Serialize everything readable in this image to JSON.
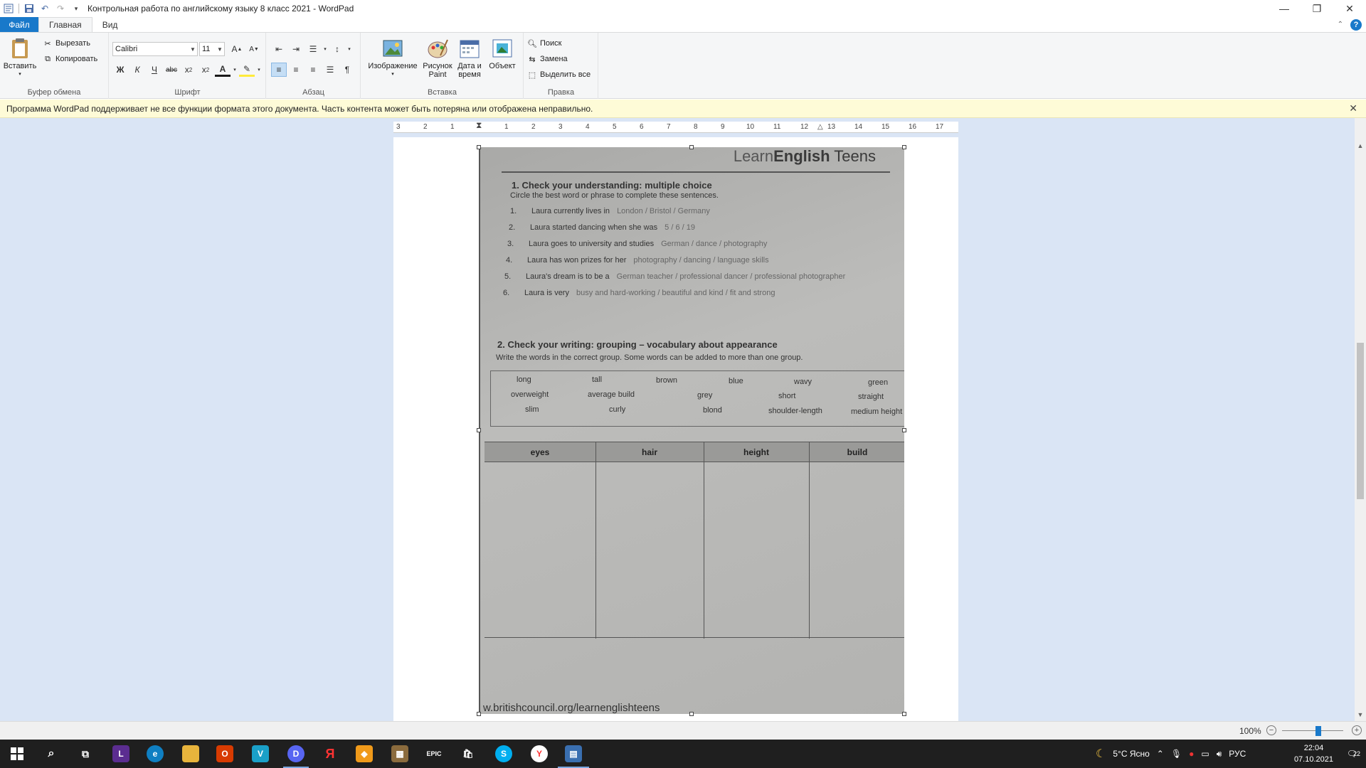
{
  "titlebar": {
    "title": "Контрольная работа по английскому языку 8 класс 2021 - WordPad"
  },
  "tabs": {
    "file": "Файл",
    "home": "Главная",
    "view": "Вид"
  },
  "clipboard": {
    "paste": "Вставить",
    "cut": "Вырезать",
    "copy": "Копировать",
    "label": "Буфер обмена"
  },
  "font": {
    "family": "Calibri",
    "size": "11",
    "label": "Шрифт"
  },
  "paragraph": {
    "label": "Абзац"
  },
  "insert": {
    "image": "Изображение",
    "paint": "Рисунок Paint",
    "datetime": "Дата и время",
    "object": "Объект",
    "label": "Вставка"
  },
  "editing": {
    "find": "Поиск",
    "replace": "Замена",
    "select_all": "Выделить все",
    "label": "Правка"
  },
  "infobar": {
    "message": "Программа WordPad поддерживает не все функции формата этого документа. Часть контента может быть потеряна или отображена неправильно."
  },
  "ruler": {
    "ticks": [
      "3",
      "2",
      "1",
      "1",
      "2",
      "3",
      "4",
      "5",
      "6",
      "7",
      "8",
      "9",
      "10",
      "11",
      "12",
      "13",
      "14",
      "15",
      "16",
      "17"
    ]
  },
  "photo": {
    "brand_light": "Learn",
    "brand_bold": "English",
    "brand_tail": "Teens",
    "section1_title": "1. Check your understanding: multiple choice",
    "section1_instr": "Circle the best word or phrase to complete these sentences.",
    "items": [
      {
        "n": "1.",
        "text": "Laura currently lives in",
        "opts": "London / Bristol / Germany"
      },
      {
        "n": "2.",
        "text": "Laura started dancing when she was",
        "opts": "5 / 6 / 19"
      },
      {
        "n": "3.",
        "text": "Laura goes to university and studies",
        "opts": "German / dance / photography"
      },
      {
        "n": "4.",
        "text": "Laura has won prizes for her",
        "opts": "photography / dancing / language skills"
      },
      {
        "n": "5.",
        "text": "Laura's dream is to be a",
        "opts": "German teacher / professional dancer / professional photographer"
      },
      {
        "n": "6.",
        "text": "Laura is very",
        "opts": "busy and hard-working / beautiful and kind / fit and strong"
      }
    ],
    "section2_title": "2. Check your writing: grouping – vocabulary about appearance",
    "section2_instr": "Write the words in the correct group. Some words can be added to more than one group.",
    "words": [
      "long",
      "tall",
      "brown",
      "blue",
      "wavy",
      "green",
      "overweight",
      "average build",
      "grey",
      "short",
      "straight",
      "slim",
      "curly",
      "blond",
      "shoulder-length",
      "medium height"
    ],
    "table_headers": [
      "eyes",
      "hair",
      "height",
      "build"
    ],
    "url": "w.britishcouncil.org/learnenglishteens"
  },
  "status": {
    "zoom": "100%",
    "zoom_level_percent": 100
  },
  "taskbar": {
    "weather": "5°C  Ясно",
    "lang": "РУС",
    "time": "22:04",
    "date": "07.10.2021",
    "notifications": "22"
  },
  "colors": {
    "accent": "#1979ca",
    "infobar": "#fefbd7",
    "doc_bg": "#dae5f5",
    "taskbar": "#1f1f1f"
  }
}
